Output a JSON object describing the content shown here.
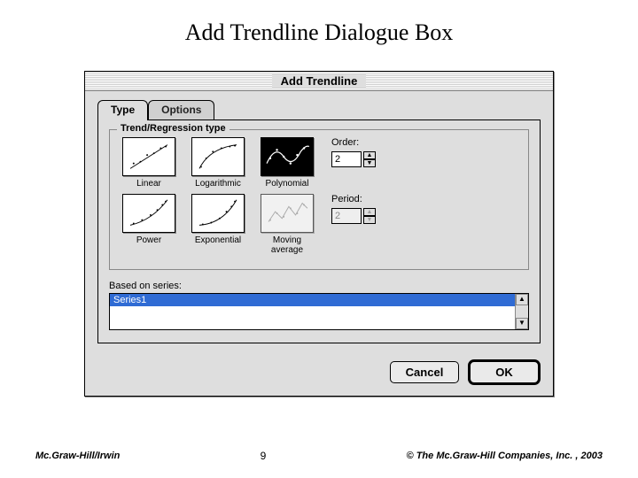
{
  "slide": {
    "title": "Add Trendline Dialogue Box"
  },
  "dialog": {
    "title": "Add Trendline",
    "tabs": {
      "type": "Type",
      "options": "Options"
    },
    "group_label": "Trend/Regression type",
    "trend_types": {
      "linear": "Linear",
      "logarithmic": "Logarithmic",
      "polynomial": "Polynomial",
      "power": "Power",
      "exponential": "Exponential",
      "moving_average": "Moving average"
    },
    "order": {
      "label": "Order:",
      "value": "2"
    },
    "period": {
      "label": "Period:",
      "value": "2"
    },
    "based_on": {
      "label": "Based on series:",
      "items": [
        "Series1"
      ],
      "selected": "Series1"
    },
    "buttons": {
      "cancel": "Cancel",
      "ok": "OK"
    }
  },
  "footer": {
    "left": "Mc.Graw-Hill/Irwin",
    "page": "9",
    "right": "© The Mc.Graw-Hill Companies, Inc. , 2003"
  }
}
